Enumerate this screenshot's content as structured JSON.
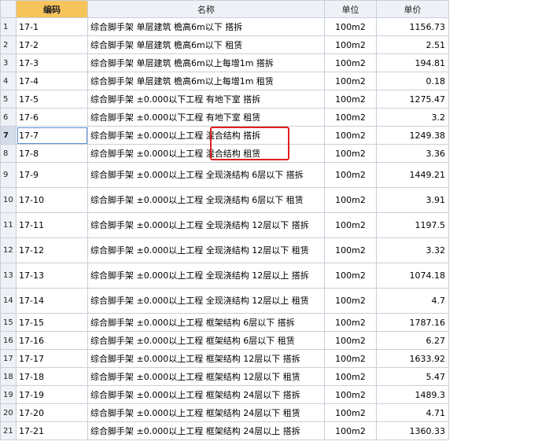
{
  "headers": {
    "index": "",
    "code": "编码",
    "name": "名称",
    "unit": "单位",
    "price": "单价"
  },
  "selected_row": 7,
  "rows": [
    {
      "n": "1",
      "code": "17-1",
      "name": "综合脚手架 单层建筑 檐高6m以下 搭拆",
      "unit": "100m2",
      "price": "1156.73"
    },
    {
      "n": "2",
      "code": "17-2",
      "name": "综合脚手架 单层建筑 檐高6m以下 租赁",
      "unit": "100m2",
      "price": "2.51"
    },
    {
      "n": "3",
      "code": "17-3",
      "name": "综合脚手架 单层建筑 檐高6m以上每增1m 搭拆",
      "unit": "100m2",
      "price": "194.81"
    },
    {
      "n": "4",
      "code": "17-4",
      "name": "综合脚手架 单层建筑 檐高6m以上每增1m 租赁",
      "unit": "100m2",
      "price": "0.18"
    },
    {
      "n": "5",
      "code": "17-5",
      "name": "综合脚手架 ±0.000以下工程 有地下室 搭拆",
      "unit": "100m2",
      "price": "1275.47"
    },
    {
      "n": "6",
      "code": "17-6",
      "name": "综合脚手架 ±0.000以下工程 有地下室 租赁",
      "unit": "100m2",
      "price": "3.2"
    },
    {
      "n": "7",
      "code": "17-7",
      "name": "综合脚手架 ±0.000以上工程 混合结构 搭拆",
      "unit": "100m2",
      "price": "1249.38"
    },
    {
      "n": "8",
      "code": "17-8",
      "name": "综合脚手架 ±0.000以上工程 混合结构 租赁",
      "unit": "100m2",
      "price": "3.36"
    },
    {
      "n": "9",
      "code": "17-9",
      "name": "综合脚手架 ±0.000以上工程 全现浇结构 6层以下 搭拆",
      "unit": "100m2",
      "price": "1449.21"
    },
    {
      "n": "10",
      "code": "17-10",
      "name": "综合脚手架 ±0.000以上工程 全现浇结构 6层以下 租赁",
      "unit": "100m2",
      "price": "3.91"
    },
    {
      "n": "11",
      "code": "17-11",
      "name": "综合脚手架 ±0.000以上工程 全现浇结构 12层以下 搭拆",
      "unit": "100m2",
      "price": "1197.5"
    },
    {
      "n": "12",
      "code": "17-12",
      "name": "综合脚手架 ±0.000以上工程 全现浇结构 12层以下 租赁",
      "unit": "100m2",
      "price": "3.32"
    },
    {
      "n": "13",
      "code": "17-13",
      "name": "综合脚手架 ±0.000以上工程 全现浇结构 12层以上 搭拆",
      "unit": "100m2",
      "price": "1074.18"
    },
    {
      "n": "14",
      "code": "17-14",
      "name": "综合脚手架 ±0.000以上工程 全现浇结构 12层以上 租赁",
      "unit": "100m2",
      "price": "4.7"
    },
    {
      "n": "15",
      "code": "17-15",
      "name": "综合脚手架 ±0.000以上工程 框架结构 6层以下 搭拆",
      "unit": "100m2",
      "price": "1787.16"
    },
    {
      "n": "16",
      "code": "17-16",
      "name": "综合脚手架 ±0.000以上工程 框架结构 6层以下 租赁",
      "unit": "100m2",
      "price": "6.27"
    },
    {
      "n": "17",
      "code": "17-17",
      "name": "综合脚手架 ±0.000以上工程 框架结构 12层以下 搭拆",
      "unit": "100m2",
      "price": "1633.92"
    },
    {
      "n": "18",
      "code": "17-18",
      "name": "综合脚手架 ±0.000以上工程 框架结构 12层以下 租赁",
      "unit": "100m2",
      "price": "5.47"
    },
    {
      "n": "19",
      "code": "17-19",
      "name": "综合脚手架 ±0.000以上工程 框架结构 24层以下 搭拆",
      "unit": "100m2",
      "price": "1489.3"
    },
    {
      "n": "20",
      "code": "17-20",
      "name": "综合脚手架 ±0.000以上工程 框架结构 24层以下 租赁",
      "unit": "100m2",
      "price": "4.71"
    },
    {
      "n": "21",
      "code": "17-21",
      "name": "综合脚手架 ±0.000以上工程 框架结构 24层以上 搭拆",
      "unit": "100m2",
      "price": "1360.33"
    }
  ]
}
